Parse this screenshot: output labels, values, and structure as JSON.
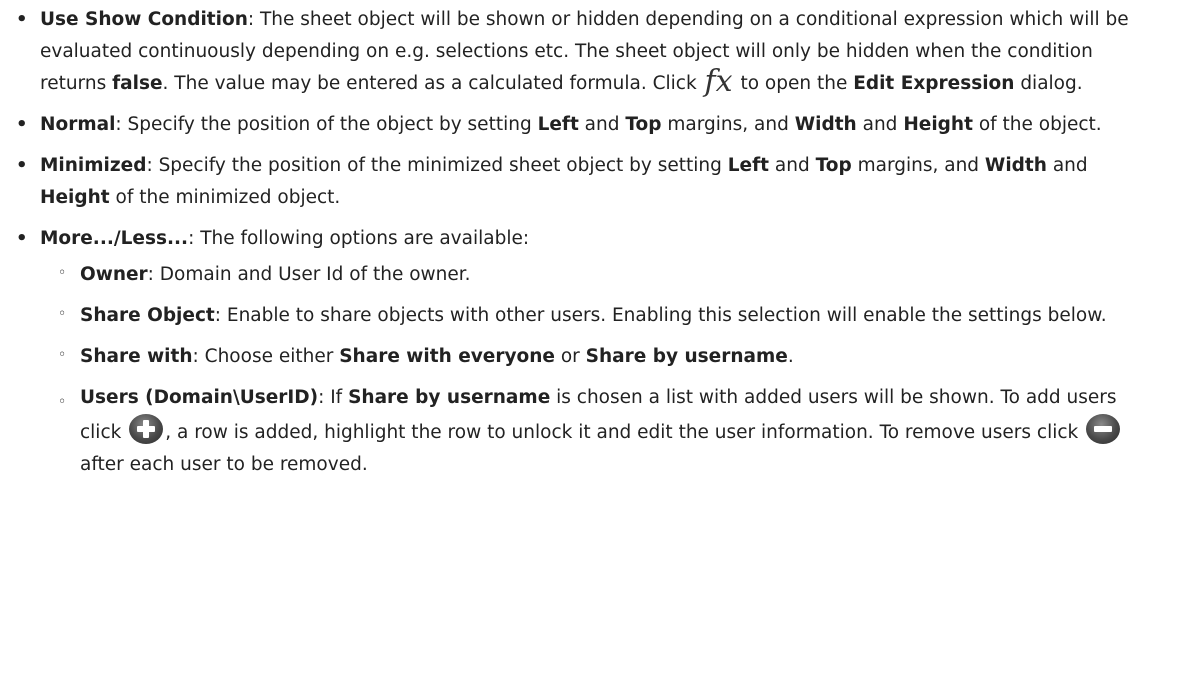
{
  "bullets": {
    "l1": "•",
    "l2": "◦"
  },
  "items": [
    {
      "term": "Use Show Condition",
      "parts": {
        "a": ": The sheet object will be shown or hidden depending on a conditional expression which will be evaluated continuously depending on e.g. selections etc. The sheet object will only be hidden when the condition returns ",
        "b": "false",
        "c": ". The value may be entered as a calculated formula. Click ",
        "fx": "fx",
        "d": " to open the ",
        "e": "Edit Expression",
        "f": " dialog."
      }
    },
    {
      "term": "Normal",
      "parts": {
        "a": ": Specify the position of the object by setting ",
        "b": "Left",
        "c": " and ",
        "d": "Top",
        "e": " margins, and ",
        "f": "Width",
        "g": " and ",
        "h": "Height",
        "i": " of the object."
      }
    },
    {
      "term": "Minimized",
      "parts": {
        "a": ": Specify the position of the minimized sheet object by setting ",
        "b": "Left",
        "c": " and ",
        "d": "Top",
        "e": " margins, and ",
        "f": "Width",
        "g": " and ",
        "h": "Height",
        "i": " of the minimized object."
      }
    },
    {
      "term": "More.../Less...",
      "parts": {
        "a": ": The following options are available:"
      },
      "subitems": [
        {
          "term": "Owner",
          "text": ": Domain and User Id of the owner."
        },
        {
          "term": "Share Object",
          "text": ": Enable to share objects with other users. Enabling this selection will enable the settings below."
        },
        {
          "term": "Share with",
          "parts": {
            "a": ": Choose either ",
            "b": "Share with everyone",
            "c": " or ",
            "d": "Share by username",
            "e": "."
          }
        },
        {
          "term": "Users (Domain\\UserID)",
          "parts": {
            "a": ": If ",
            "b": "Share by username",
            "c": " is chosen a list with added users will be shown. To add users click ",
            "add_icon": "add-circle-icon",
            "d": ", a row is added, highlight the row to unlock it and edit the user information. To remove users click ",
            "remove_icon": "remove-circle-icon",
            "e": " after each user to be removed."
          }
        }
      ]
    }
  ]
}
